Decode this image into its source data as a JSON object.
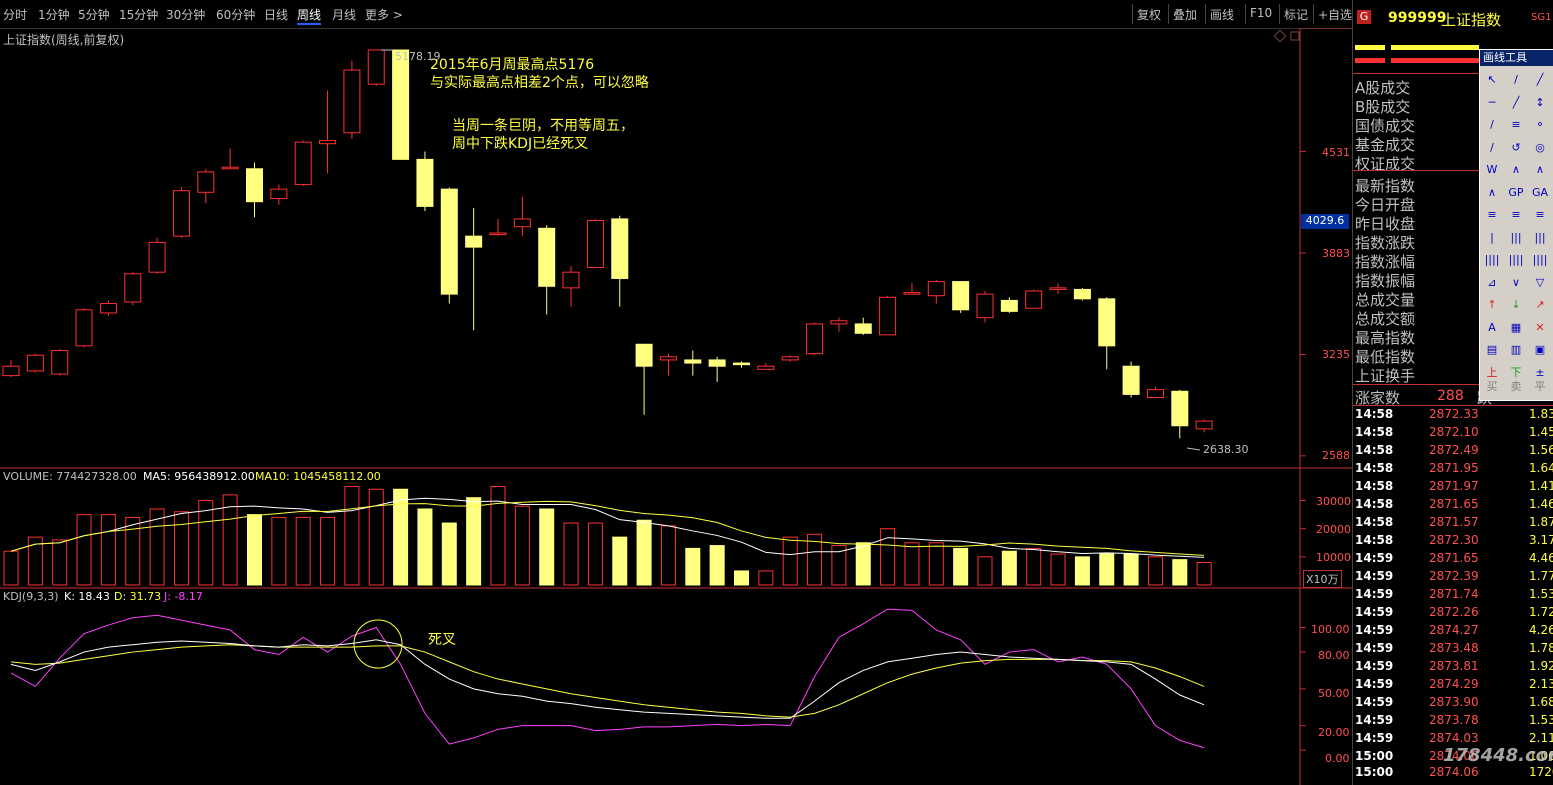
{
  "toolbar": {
    "periods": [
      "分时",
      "1分钟",
      "5分钟",
      "15分钟",
      "30分钟",
      "60分钟",
      "日线",
      "周线",
      "月线",
      "更多 >"
    ],
    "active_period": "周线",
    "right_buttons": [
      "复权",
      "叠加",
      "画线",
      "F10",
      "标记",
      "+自选"
    ]
  },
  "chart": {
    "title": "上证指数(周线,前复权)",
    "price_labels": [
      "4531",
      "4029.6",
      "3883",
      "3235",
      "2588"
    ],
    "high_label": "5178.19",
    "low_label": "2638.30",
    "annotation1_line1": "2015年6月周最高点5176",
    "annotation1_line2": "与实际最高点相差2个点，可以忽略",
    "annotation2_line1": "当周一条巨阴，不用等周五，",
    "annotation2_line2": "周中下跌KDJ已经死叉",
    "annotation3": "死叉",
    "colors": {
      "up": "#ff3030",
      "down": "#ffff80",
      "ma5": "#ffffff",
      "ma10": "#ffff40",
      "j": "#ff40ff"
    }
  },
  "volume": {
    "label_volume": "VOLUME: 774427328.00",
    "label_ma5": "MA5: 956438912.00",
    "label_ma10": "MA10: 1045458112.00",
    "axis_labels": [
      "30000",
      "20000",
      "10000"
    ],
    "unit": "X10万"
  },
  "kdj": {
    "label_name": "KDJ(9,3,3)",
    "label_k": "K: 18.43",
    "label_d": "D: 31.73",
    "label_j": "J: -8.17",
    "axis_labels": [
      "100.00",
      "80.00",
      "50.00",
      "20.00",
      "0.00"
    ]
  },
  "chart_data": {
    "type": "candlestick",
    "candles": [
      [
        3100,
        3160,
        3200,
        3090
      ],
      [
        3130,
        3230,
        3240,
        3120
      ],
      [
        3110,
        3260,
        3270,
        3100
      ],
      [
        3290,
        3520,
        3530,
        3280
      ],
      [
        3500,
        3560,
        3580,
        3480
      ],
      [
        3570,
        3750,
        3760,
        3550
      ],
      [
        3760,
        3950,
        3980,
        3750
      ],
      [
        3990,
        4280,
        4300,
        3980
      ],
      [
        4270,
        4400,
        4420,
        4200
      ],
      [
        4420,
        4430,
        4550,
        4420
      ],
      [
        4420,
        4210,
        4460,
        4110
      ],
      [
        4230,
        4290,
        4320,
        4190
      ],
      [
        4320,
        4590,
        4600,
        4310
      ],
      [
        4580,
        4600,
        4920,
        4390
      ],
      [
        4650,
        5050,
        5110,
        4610
      ],
      [
        4960,
        5178,
        5178,
        4950
      ],
      [
        5178,
        4480,
        5178,
        4480
      ],
      [
        4480,
        4180,
        4530,
        4150
      ],
      [
        4290,
        3620,
        4300,
        3560
      ],
      [
        3990,
        3920,
        4170,
        3390
      ],
      [
        4000,
        4010,
        4100,
        3990
      ],
      [
        4050,
        4100,
        4240,
        3990
      ],
      [
        4040,
        3670,
        4060,
        3490
      ],
      [
        3660,
        3760,
        3800,
        3540
      ],
      [
        3790,
        4090,
        4100,
        3790
      ],
      [
        4100,
        3720,
        4120,
        3540
      ],
      [
        3300,
        3160,
        3300,
        2850
      ],
      [
        3200,
        3220,
        3240,
        3100
      ],
      [
        3200,
        3180,
        3260,
        3100
      ],
      [
        3200,
        3160,
        3220,
        3060
      ],
      [
        3180,
        3170,
        3190,
        3150
      ],
      [
        3140,
        3160,
        3180,
        3140
      ],
      [
        3200,
        3220,
        3230,
        3190
      ],
      [
        3240,
        3430,
        3440,
        3230
      ],
      [
        3430,
        3450,
        3470,
        3380
      ],
      [
        3430,
        3370,
        3470,
        3360
      ],
      [
        3360,
        3600,
        3610,
        3360
      ],
      [
        3620,
        3630,
        3690,
        3620
      ],
      [
        3610,
        3700,
        3710,
        3560
      ],
      [
        3700,
        3520,
        3700,
        3500
      ],
      [
        3470,
        3620,
        3640,
        3440
      ],
      [
        3580,
        3510,
        3600,
        3500
      ],
      [
        3530,
        3640,
        3650,
        3530
      ],
      [
        3650,
        3660,
        3690,
        3620
      ],
      [
        3650,
        3590,
        3660,
        3580
      ],
      [
        3590,
        3290,
        3600,
        3140
      ],
      [
        3160,
        2980,
        3190,
        2960
      ],
      [
        2960,
        3010,
        3030,
        2960
      ],
      [
        3000,
        2780,
        3010,
        2700
      ],
      [
        2760,
        2810,
        2820,
        2738
      ]
    ],
    "volume": [
      12000,
      17000,
      16000,
      25000,
      25000,
      24000,
      27000,
      26000,
      30000,
      32000,
      25000,
      24000,
      24000,
      24000,
      35000,
      34000,
      34000,
      27000,
      22000,
      31000,
      35000,
      28000,
      27000,
      22000,
      22000,
      17000,
      23000,
      21000,
      13000,
      14000,
      5000,
      5000,
      17000,
      18000,
      14000,
      15000,
      20000,
      15000,
      15000,
      13000,
      10000,
      12000,
      13000,
      11000,
      10000,
      11000,
      11000,
      10000,
      9000,
      8000
    ],
    "kdj_k": [
      70,
      65,
      72,
      80,
      84,
      86,
      88,
      89,
      88,
      87,
      85,
      84,
      86,
      85,
      87,
      90,
      86,
      70,
      58,
      50,
      46,
      44,
      40,
      38,
      35,
      33,
      31,
      30,
      29,
      28,
      27,
      26,
      26,
      40,
      55,
      65,
      72,
      75,
      78,
      80,
      78,
      76,
      75,
      74,
      73,
      72,
      70,
      58,
      45,
      37
    ],
    "kdj_d": [
      72,
      70,
      71,
      74,
      77,
      80,
      82,
      84,
      85,
      86,
      85,
      84,
      84,
      84,
      84,
      85,
      85,
      80,
      72,
      64,
      58,
      54,
      50,
      46,
      43,
      40,
      37,
      35,
      33,
      31,
      30,
      28,
      27,
      30,
      37,
      46,
      55,
      62,
      67,
      71,
      73,
      74,
      74,
      74,
      73,
      73,
      72,
      67,
      60,
      52
    ],
    "kdj_j": [
      63,
      52,
      75,
      95,
      102,
      108,
      110,
      106,
      102,
      98,
      82,
      78,
      92,
      80,
      93,
      100,
      70,
      30,
      5,
      10,
      17,
      20,
      20,
      20,
      16,
      17,
      19,
      19,
      20,
      21,
      20,
      21,
      20,
      60,
      92,
      103,
      115,
      114,
      98,
      90,
      70,
      80,
      82,
      72,
      76,
      70,
      50,
      20,
      8,
      2
    ]
  }
}
